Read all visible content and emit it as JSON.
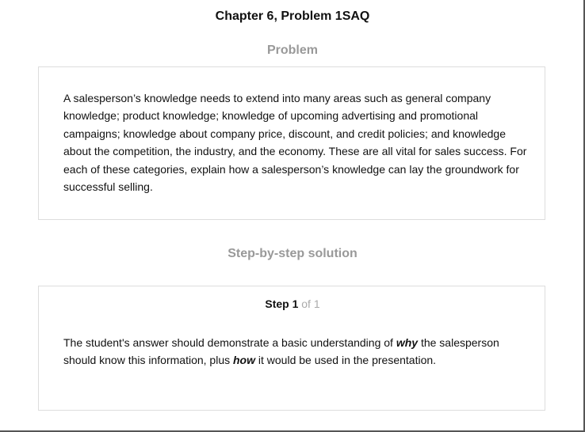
{
  "page": {
    "title": "Chapter 6, Problem 1SAQ"
  },
  "problem": {
    "heading": "Problem",
    "text": "A salesperson’s knowledge needs to extend into many areas such as general company knowledge; product knowledge; knowledge of upcoming advertising and promotional campaigns; knowledge about company price, discount, and credit policies; and knowledge about the competition, the industry, and the economy. These are all vital for sales success. For each of these categories, explain how a salesperson’s knowledge can lay the groundwork for successful selling."
  },
  "solution": {
    "heading": "Step-by-step solution",
    "step": {
      "label": "Step 1",
      "total": "of 1",
      "text_part1": "The student's answer should demonstrate a basic understanding of ",
      "emphasis1": "why",
      "text_part2": " the salesperson should know this information, plus ",
      "emphasis2": "how",
      "text_part3": " it would be used in the presentation."
    }
  }
}
